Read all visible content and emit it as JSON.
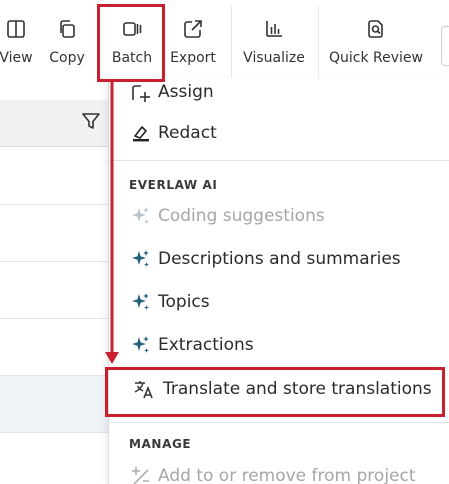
{
  "toolbar": {
    "view_label": "View",
    "copy_label": "Copy",
    "batch_label": "Batch",
    "export_label": "Export",
    "visualize_label": "Visualize",
    "quick_review_label": "Quick Review"
  },
  "menu": {
    "assign_label": "Assign",
    "redact_label": "Redact",
    "everlaw_ai_heading": "EVERLAW AI",
    "coding_suggestions_label": "Coding suggestions",
    "descriptions_label": "Descriptions and summaries",
    "topics_label": "Topics",
    "extractions_label": "Extractions",
    "translate_label": "Translate and store translations",
    "manage_heading": "MANAGE",
    "add_project_label": "Add to or remove from project"
  },
  "colors": {
    "highlight": "#c8202f",
    "ai_sparkle": "#1f5f7a",
    "disabled_text": "#a6a6a6"
  },
  "icons": [
    "view-icon",
    "copy-icon",
    "batch-icon",
    "export-icon",
    "visualize-icon",
    "quick-review-icon",
    "filter-icon",
    "assign-icon",
    "redact-icon",
    "sparkle-icon",
    "translate-icon",
    "add-remove-project-icon"
  ]
}
